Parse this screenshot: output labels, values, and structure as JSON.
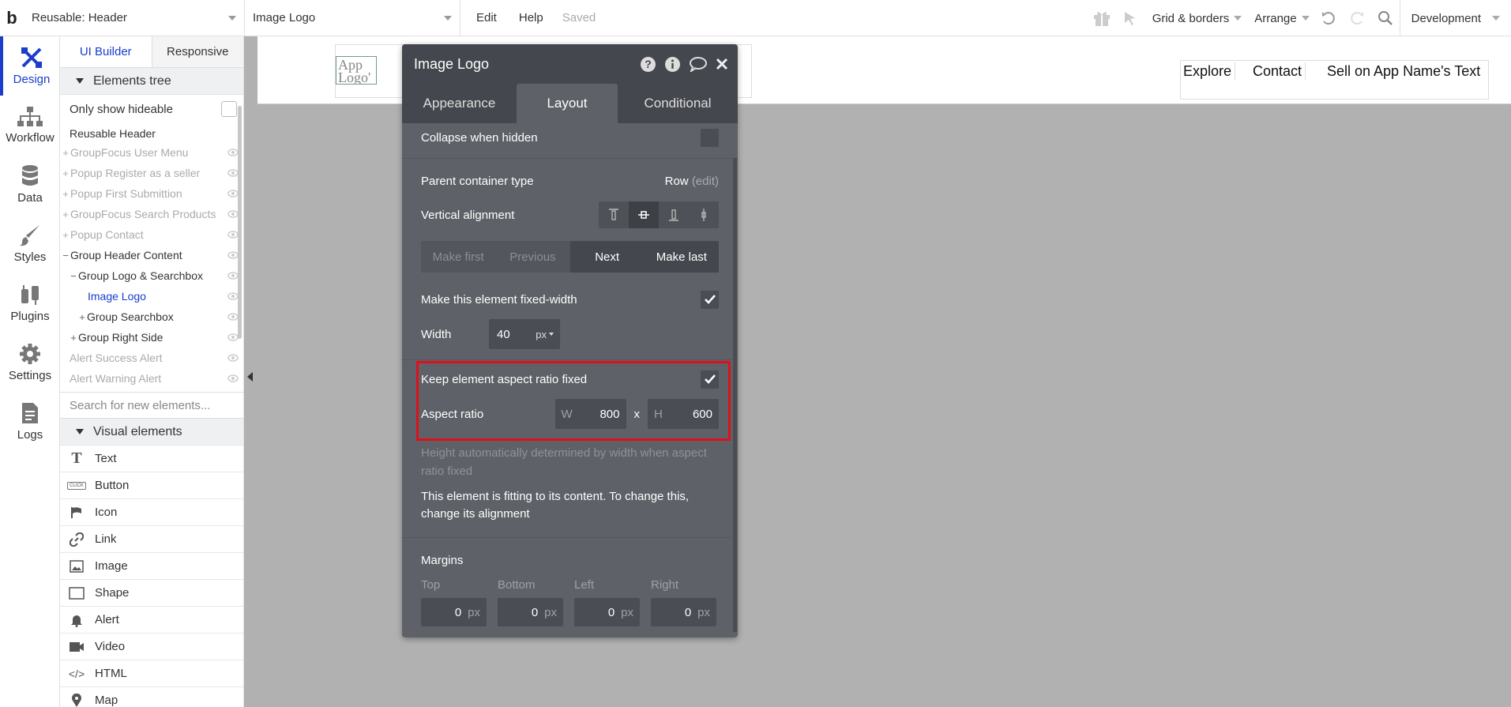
{
  "topbar": {
    "logo": "b",
    "page_select": "Reusable: Header",
    "element_select": "Image Logo",
    "edit": "Edit",
    "help": "Help",
    "saved": "Saved",
    "grid_borders": "Grid & borders",
    "arrange": "Arrange",
    "environment": "Development"
  },
  "rail": [
    {
      "label": "Design",
      "icon": "design-icon"
    },
    {
      "label": "Workflow",
      "icon": "workflow-icon"
    },
    {
      "label": "Data",
      "icon": "database-icon"
    },
    {
      "label": "Styles",
      "icon": "brush-icon"
    },
    {
      "label": "Plugins",
      "icon": "plugin-icon"
    },
    {
      "label": "Settings",
      "icon": "gear-icon"
    },
    {
      "label": "Logs",
      "icon": "document-icon"
    }
  ],
  "sidebar": {
    "tabs": [
      "UI Builder",
      "Responsive"
    ],
    "elements_tree": "Elements tree",
    "only_show_hideable": "Only show hideable",
    "tree": [
      {
        "label": "Reusable Header"
      },
      {
        "label": "GroupFocus User Menu"
      },
      {
        "label": "Popup Register as a seller"
      },
      {
        "label": "Popup First Submittion"
      },
      {
        "label": "GroupFocus Search Products"
      },
      {
        "label": "Popup Contact"
      },
      {
        "label": "Group Header Content"
      },
      {
        "label": "Group Logo & Searchbox"
      },
      {
        "label": "Image Logo"
      },
      {
        "label": "Group Searchbox"
      },
      {
        "label": "Group Right Side"
      },
      {
        "label": "Alert Success Alert"
      },
      {
        "label": "Alert Warning Alert"
      }
    ],
    "search_placeholder": "Search for new elements...",
    "visual_elements": "Visual elements",
    "visual": [
      {
        "label": "Text",
        "icon": "text-icon"
      },
      {
        "label": "Button",
        "icon": "button-icon"
      },
      {
        "label": "Icon",
        "icon": "flag-icon"
      },
      {
        "label": "Link",
        "icon": "link-icon"
      },
      {
        "label": "Image",
        "icon": "image-icon"
      },
      {
        "label": "Shape",
        "icon": "shape-icon"
      },
      {
        "label": "Alert",
        "icon": "bell-icon"
      },
      {
        "label": "Video",
        "icon": "video-icon"
      },
      {
        "label": "HTML",
        "icon": "code-icon"
      },
      {
        "label": "Map",
        "icon": "map-pin-icon"
      }
    ],
    "button_icon_text": "CLICK"
  },
  "canvas": {
    "app_logo": "App Logo'",
    "nav": [
      "Explore",
      "Contact",
      "Sell on App Name's Text"
    ]
  },
  "editor": {
    "title": "Image Logo",
    "tabs": [
      "Appearance",
      "Layout",
      "Conditional"
    ],
    "collapse_when_hidden": "Collapse when hidden",
    "parent_container_type": "Parent container type",
    "parent_value": "Row",
    "parent_edit": "(edit)",
    "vertical_alignment": "Vertical alignment",
    "order_buttons": [
      "Make first",
      "Previous",
      "Next",
      "Make last"
    ],
    "fixed_width": "Make this element fixed-width",
    "width_label": "Width",
    "width_value": "40",
    "width_unit": "px",
    "keep_ratio": "Keep element aspect ratio fixed",
    "aspect_ratio": "Aspect ratio",
    "w_label": "W",
    "w_value": "800",
    "x": "x",
    "h_label": "H",
    "h_value": "600",
    "height_note": "Height automatically determined by width when aspect ratio fixed",
    "fit_note": "This element is fitting to its content. To change this, change its alignment",
    "margins": "Margins",
    "margin_labels": [
      "Top",
      "Bottom",
      "Left",
      "Right"
    ],
    "margin_values": [
      "0",
      "0",
      "0",
      "0"
    ],
    "margin_unit": "px"
  },
  "colors": {
    "accent": "#1a3dcc",
    "highlight": "#e0101a",
    "editor_bg": "#5e6167",
    "editor_header": "#44474d",
    "canvas": "#b1b1b1"
  }
}
